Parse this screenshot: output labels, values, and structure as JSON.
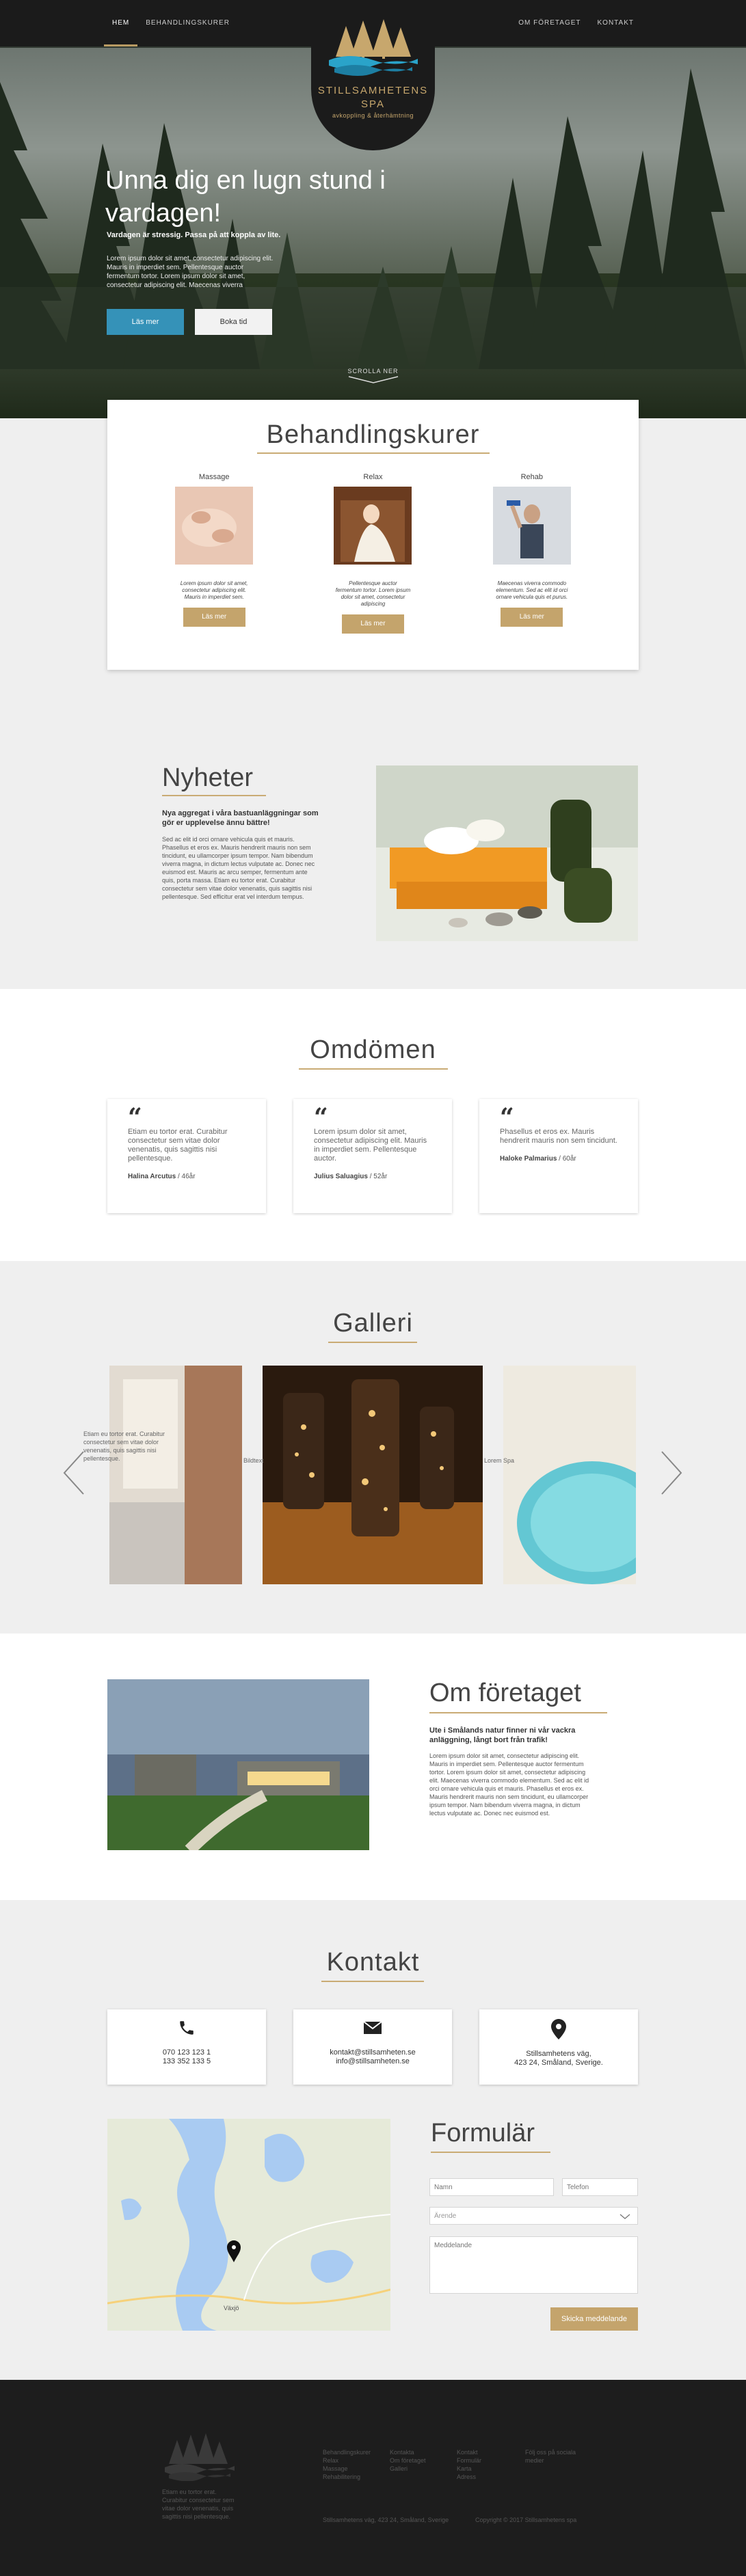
{
  "nav": {
    "left": [
      "Hem",
      "Behandlingskurer"
    ],
    "right": [
      "Om företaget",
      "Kontakt"
    ]
  },
  "logo": {
    "title_line1": "STILLSAMHETENS",
    "title_line2": "SPA",
    "tagline": "avkoppling & återhämtning"
  },
  "hero": {
    "title": "Unna dig en lugn stund i vardagen!",
    "subtitle": "Vardagen är stressig. Passa på att koppla av lite.",
    "text": "Lorem ipsum dolor sit amet, consectetur adipiscing elit. Mauris in imperdiet sem. Pellentesque auctor fermentum tortor. Lorem ipsum dolor sit amet, consectetur adipiscing elit. Maecenas viverra",
    "btn_primary": "Läs mer",
    "btn_secondary": "Boka tid",
    "scroll_hint": "Scrolla ner"
  },
  "treatments": {
    "title": "Behandlingskurer",
    "items": [
      {
        "name": "Massage",
        "desc": "Lorem ipsum dolor sit amet, consectetur adipiscing elit. Mauris in imperdiet sem.",
        "button": "Läs mer"
      },
      {
        "name": "Relax",
        "desc": "Pellentesque auctor fermentum tortor. Lorem ipsum dolor sit amet, consectetur adipiscing",
        "button": "Läs mer"
      },
      {
        "name": "Rehab",
        "desc": "Maecenas viverra commodo elementum. Sed ac elit id orci ornare vehicula quis et purus.",
        "button": "Läs mer"
      }
    ]
  },
  "news": {
    "title": "Nyheter",
    "lead": "Nya aggregat i våra bastuanläggningar som gör er upplevelse ännu bättre!",
    "text": "Sed ac elit id orci ornare vehicula quis et mauris. Phasellus et eros ex. Mauris hendrerit mauris non sem tincidunt, eu ullamcorper ipsum tempor. Nam bibendum viverra magna, in dictum lectus vulputate ac. Donec nec euismod est. Mauris ac arcu semper, fermentum ante quis, porta massa. Etiam eu tortor erat. Curabitur consectetur sem vitae dolor venenatis, quis sagittis nisi pellentesque. Sed efficitur erat vel interdum tempus."
  },
  "reviews": {
    "title": "Omdömen",
    "items": [
      {
        "text": "Etiam eu tortor erat. Curabitur consectetur sem vitae dolor venenatis, quis sagittis nisi pellentesque.",
        "name": "Halina Arcutus",
        "age": " / 46år"
      },
      {
        "text": "Lorem ipsum dolor sit amet, consectetur adipiscing elit. Mauris in imperdiet sem. Pellentesque auctor.",
        "name": "Julius Saluagius",
        "age": " / 52år"
      },
      {
        "text": "Phasellus et eros ex. Mauris hendrerit mauris non sem tincidunt.",
        "name": "Haloke Palmarius",
        "age": " / 60år"
      }
    ]
  },
  "gallery": {
    "title": "Galleri",
    "side_text_left": "Etiam eu tortor erat. Curabitur consectetur sem vitae dolor venenatis, quis sagittis nisi pellentesque.",
    "side_text_mid": "Bildtext",
    "side_text_right": "Lorem Spa"
  },
  "about": {
    "title": "Om företaget",
    "lead": "Ute i Smålands natur finner ni vår vackra anläggning, långt bort från trafik!",
    "text": "Lorem ipsum dolor sit amet, consectetur adipiscing elit. Mauris in imperdiet sem. Pellentesque auctor fermentum tortor. Lorem ipsum dolor sit amet, consectetur adipiscing elit. Maecenas viverra commodo elementum. Sed ac elit id orci ornare vehicula quis et mauris. Phasellus et eros ex. Mauris hendrerit mauris non sem tincidunt, eu ullamcorper ipsum tempor. Nam bibendum viverra magna, in dictum lectus vulputate ac. Donec nec euismod est."
  },
  "contact": {
    "title": "Kontakt",
    "phone1": "070 123 123 1",
    "phone2": "133 352 133 5",
    "email1": "kontakt@stillsamheten.se",
    "email2": "info@stillsamheten.se",
    "addr1": "Stillsamhetens väg,",
    "addr2": "423 24, Småland, Sverige."
  },
  "form": {
    "title": "Formulär",
    "name_ph": "Namn",
    "phone_ph": "Telefon",
    "subject_ph": "Ärende",
    "message_ph": "Meddelande",
    "submit": "Skicka meddelande"
  },
  "map": {
    "place_label": "Växjö"
  },
  "footer": {
    "about": "Etiam eu tortor erat. Curabitur consectetur sem vitae dolor venenatis, quis sagittis nisi pellentesque.",
    "col1": [
      "Behandlingskurer",
      "Relax",
      "Massage",
      "Rehabilitering"
    ],
    "col2": [
      "Kontakta",
      "Om företaget",
      "Galleri"
    ],
    "col3": [
      "Kontakt",
      "Formulär",
      "Karta",
      "Adress"
    ],
    "col4": [
      "Följ oss på sociala",
      "medier"
    ],
    "address": "Stillsamhetens väg, 423 24, Småland, Sverige",
    "copyright": "Copyright © 2017 Stillsamhetens spa"
  },
  "colors": {
    "accent_gold": "#c4a46c",
    "accent_blue": "#3592b8",
    "dark": "#1b1b1b",
    "band_grey": "#efefef"
  }
}
